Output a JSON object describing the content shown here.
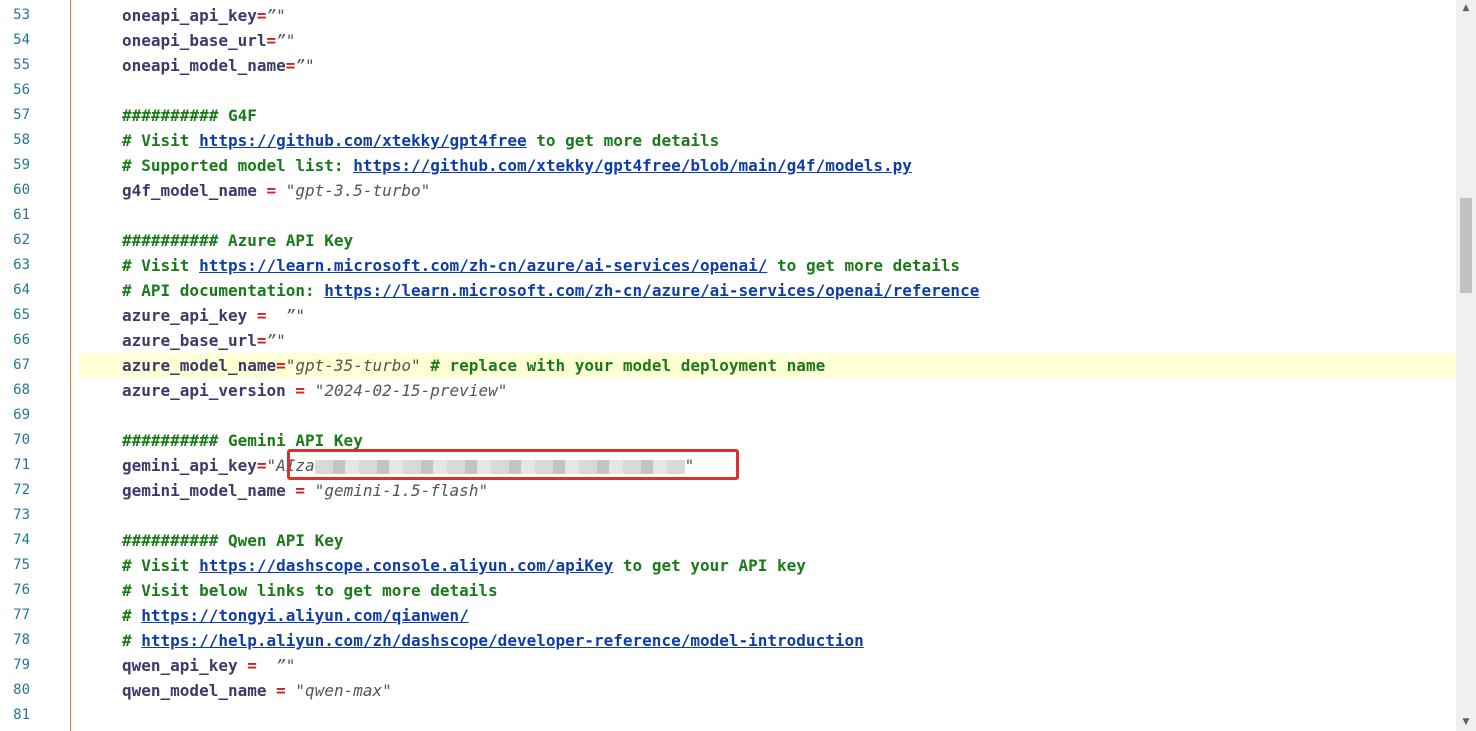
{
  "lines": [
    {
      "n": "53",
      "parts": [
        [
          "key",
          "oneapi_api_key"
        ],
        [
          "op",
          "="
        ],
        [
          "str",
          "”\""
        ]
      ]
    },
    {
      "n": "54",
      "parts": [
        [
          "key",
          "oneapi_base_url"
        ],
        [
          "op",
          "="
        ],
        [
          "str",
          "”\""
        ]
      ]
    },
    {
      "n": "55",
      "parts": [
        [
          "key",
          "oneapi_model_name"
        ],
        [
          "op",
          "="
        ],
        [
          "str",
          "”\""
        ]
      ]
    },
    {
      "n": "56",
      "parts": []
    },
    {
      "n": "57",
      "parts": [
        [
          "comment",
          "########## G4F"
        ]
      ]
    },
    {
      "n": "58",
      "parts": [
        [
          "comment",
          "# Visit "
        ],
        [
          "link",
          "https://github.com/xtekky/gpt4free"
        ],
        [
          "comment",
          " to get more details"
        ]
      ]
    },
    {
      "n": "59",
      "parts": [
        [
          "comment",
          "# Supported model list: "
        ],
        [
          "link",
          "https://github.com/xtekky/gpt4free/blob/main/g4f/models.py"
        ]
      ]
    },
    {
      "n": "60",
      "parts": [
        [
          "key",
          "g4f_model_name"
        ],
        [
          "plain",
          " "
        ],
        [
          "op",
          "="
        ],
        [
          "plain",
          " "
        ],
        [
          "str",
          "\"gpt-3.5-turbo\""
        ]
      ]
    },
    {
      "n": "61",
      "parts": []
    },
    {
      "n": "62",
      "parts": [
        [
          "comment",
          "########## Azure API Key"
        ]
      ]
    },
    {
      "n": "63",
      "parts": [
        [
          "comment",
          "# Visit "
        ],
        [
          "link",
          "https://learn.microsoft.com/zh-cn/azure/ai-services/openai/"
        ],
        [
          "comment",
          " to get more details"
        ]
      ]
    },
    {
      "n": "64",
      "parts": [
        [
          "comment",
          "# API documentation: "
        ],
        [
          "link",
          "https://learn.microsoft.com/zh-cn/azure/ai-services/openai/reference"
        ]
      ]
    },
    {
      "n": "65",
      "parts": [
        [
          "key",
          "azure_api_key"
        ],
        [
          "plain",
          " "
        ],
        [
          "op",
          "="
        ],
        [
          "plain",
          "  "
        ],
        [
          "str",
          "”\""
        ]
      ]
    },
    {
      "n": "66",
      "parts": [
        [
          "key",
          "azure_base_url"
        ],
        [
          "op",
          "="
        ],
        [
          "str",
          "”\""
        ]
      ]
    },
    {
      "n": "67",
      "parts": [
        [
          "key",
          "azure_model_name"
        ],
        [
          "op",
          "="
        ],
        [
          "str",
          "\"gpt-35-turbo\""
        ],
        [
          "comment",
          " # replace with your model deployment name"
        ]
      ]
    },
    {
      "n": "68",
      "parts": [
        [
          "key",
          "azure_api_version"
        ],
        [
          "plain",
          " "
        ],
        [
          "op",
          "="
        ],
        [
          "plain",
          " "
        ],
        [
          "str",
          "\"2024-02-15-preview\""
        ]
      ]
    },
    {
      "n": "69",
      "parts": []
    },
    {
      "n": "70",
      "parts": [
        [
          "comment",
          "########## Gemini API Key"
        ]
      ]
    },
    {
      "n": "71",
      "parts": [
        [
          "key",
          "gemini_api_key"
        ],
        [
          "op",
          "="
        ],
        [
          "str",
          "\"AIza"
        ],
        [
          "redact",
          ""
        ],
        [
          "str",
          "\""
        ]
      ]
    },
    {
      "n": "72",
      "parts": [
        [
          "key",
          "gemini_model_name"
        ],
        [
          "plain",
          " "
        ],
        [
          "op",
          "="
        ],
        [
          "plain",
          " "
        ],
        [
          "str",
          "\"gemini-1.5-flash\""
        ]
      ]
    },
    {
      "n": "73",
      "parts": []
    },
    {
      "n": "74",
      "parts": [
        [
          "comment",
          "########## Qwen API Key"
        ]
      ]
    },
    {
      "n": "75",
      "parts": [
        [
          "comment",
          "# Visit "
        ],
        [
          "link",
          "https://dashscope.console.aliyun.com/apiKey"
        ],
        [
          "comment",
          " to get your API key"
        ]
      ]
    },
    {
      "n": "76",
      "parts": [
        [
          "comment",
          "# Visit below links to get more details"
        ]
      ]
    },
    {
      "n": "77",
      "parts": [
        [
          "comment",
          "# "
        ],
        [
          "link",
          "https://tongyi.aliyun.com/qianwen/"
        ]
      ]
    },
    {
      "n": "78",
      "parts": [
        [
          "comment",
          "# "
        ],
        [
          "link",
          "https://help.aliyun.com/zh/dashscope/developer-reference/model-introduction"
        ]
      ]
    },
    {
      "n": "79",
      "parts": [
        [
          "key",
          "qwen_api_key"
        ],
        [
          "plain",
          " "
        ],
        [
          "op",
          "="
        ],
        [
          "plain",
          "  "
        ],
        [
          "str",
          "”\""
        ]
      ]
    },
    {
      "n": "80",
      "parts": [
        [
          "key",
          "qwen_model_name"
        ],
        [
          "plain",
          " "
        ],
        [
          "op",
          "="
        ],
        [
          "plain",
          " "
        ],
        [
          "str",
          "\"qwen-max\""
        ]
      ]
    },
    {
      "n": "81",
      "parts": []
    }
  ],
  "highlighted_line": "67",
  "scrollbar": {
    "up_arrow": "▲",
    "down_arrow": "▼"
  }
}
